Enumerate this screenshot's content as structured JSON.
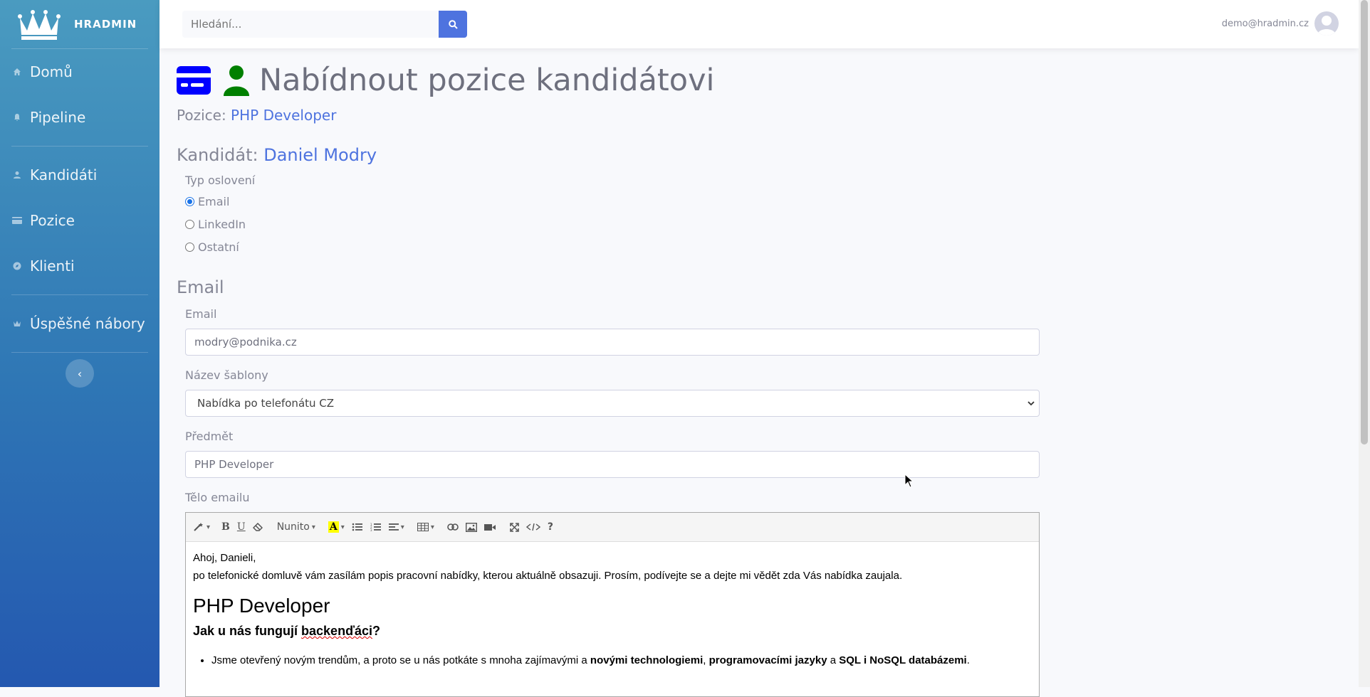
{
  "brand": {
    "name": "HRADMIN"
  },
  "sidebar": {
    "items": [
      {
        "label": "Domů",
        "icon": "home-icon"
      },
      {
        "label": "Pipeline",
        "icon": "bell-icon"
      },
      {
        "label": "Kandidáti",
        "icon": "user-icon"
      },
      {
        "label": "Pozice",
        "icon": "card-icon"
      },
      {
        "label": "Klienti",
        "icon": "compass-icon"
      },
      {
        "label": "Úspěšné nábory",
        "icon": "crown-icon"
      }
    ],
    "toggle_icon": "chevron-left-icon"
  },
  "topbar": {
    "search_placeholder": "Hledání...",
    "user_email": "demo@hradmin.cz"
  },
  "page": {
    "title": "Nabídnout pozice kandidátovi",
    "position_label": "Pozice:",
    "position_value": "PHP Developer",
    "candidate_label": "Kandidát:",
    "candidate_value": "Daniel Modry",
    "contact_type_label": "Typ oslovení",
    "contact_options": [
      "Email",
      "LinkedIn",
      "Ostatní"
    ],
    "contact_selected": "Email",
    "section_title": "Email",
    "email_label": "Email",
    "email_value": "modry@podnika.cz",
    "template_label": "Název šablony",
    "template_value": "Nabídka po telefonátu CZ",
    "subject_label": "Předmět",
    "subject_value": "PHP Developer",
    "body_label": "Tělo emailu"
  },
  "editor": {
    "font_name": "Nunito",
    "greeting": "Ahoj, Danieli,",
    "intro": "po telefonické domluvě vám zasílám popis pracovní nabídky, kterou aktuálně obsazuji. Prosím, podívejte se a dejte mi vědět zda Vás nabídka zaujala.",
    "heading": "PHP Developer",
    "subheading_pre": "Jak u nás fungují ",
    "subheading_word": "backenďáci",
    "subheading_post": "?",
    "bullet_pre": "Jsme otevřený novým trendům, a proto se u nás potkáte s mnoha zajímavými a ",
    "bullet_b1": "novými technologiemi",
    "bullet_sep": ", ",
    "bullet_b2": "programovacími jazyky",
    "bullet_mid": " a ",
    "bullet_b3": "SQL i NoSQL databázemi",
    "bullet_end": "."
  },
  "colors": {
    "primary": "#4e73df",
    "sidebar_top": "#4a9bc0",
    "sidebar_bottom": "#2458b0",
    "icon_blue": "#0000ff",
    "icon_green": "#008000"
  }
}
